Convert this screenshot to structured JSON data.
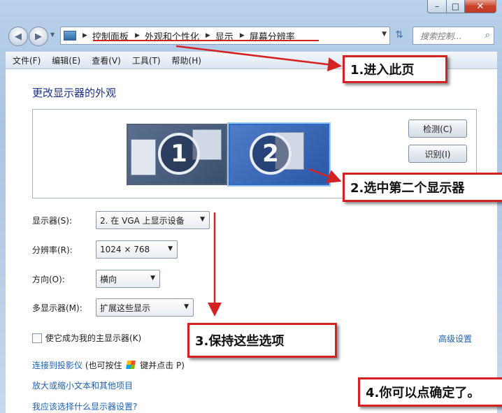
{
  "window": {
    "caption_buttons": {
      "minimize": "–",
      "maximize": "□",
      "close": "✕"
    }
  },
  "nav": {
    "breadcrumbs": [
      "控制面板",
      "外观和个性化",
      "显示",
      "屏幕分辨率"
    ],
    "search_placeholder": "搜索控制...",
    "icons": {
      "back": "back-arrow-icon",
      "forward": "forward-arrow-icon",
      "refresh": "refresh-icon",
      "search": "search-icon",
      "address": "control-panel-icon"
    }
  },
  "menu": [
    "文件(F)",
    "编辑(E)",
    "查看(V)",
    "工具(T)",
    "帮助(H)"
  ],
  "page": {
    "title": "更改显示器的外观",
    "monitors": [
      {
        "number": "1",
        "selected": false
      },
      {
        "number": "2",
        "selected": true
      }
    ],
    "detect_button": "检测(C)",
    "identify_button": "识别(I)",
    "settings": {
      "display_label": "显示器(S):",
      "display_value": "2. 在 VGA 上显示设备",
      "resolution_label": "分辨率(R):",
      "resolution_value": "1024 × 768",
      "orientation_label": "方向(O):",
      "orientation_value": "横向",
      "multi_label": "多显示器(M):",
      "multi_value": "扩展这些显示"
    },
    "primary_checkbox": {
      "label": "使它成为我的主显示器(K)",
      "checked": false
    },
    "advanced_link": "高级设置",
    "links": {
      "projector": "连接到投影仪",
      "projector_hint_1": "(也可按住",
      "projector_hint_2": "键并点击 P)",
      "text_size": "放大或缩小文本和其他项目",
      "which_settings": "我应该选择什么显示器设置?"
    }
  },
  "annotations": {
    "step1": "1.进入此页",
    "step2": "2.选中第二个显示器",
    "step3": "3.保持这些选项",
    "step4": "4.你可以点确定了。",
    "color": "#d42222"
  }
}
